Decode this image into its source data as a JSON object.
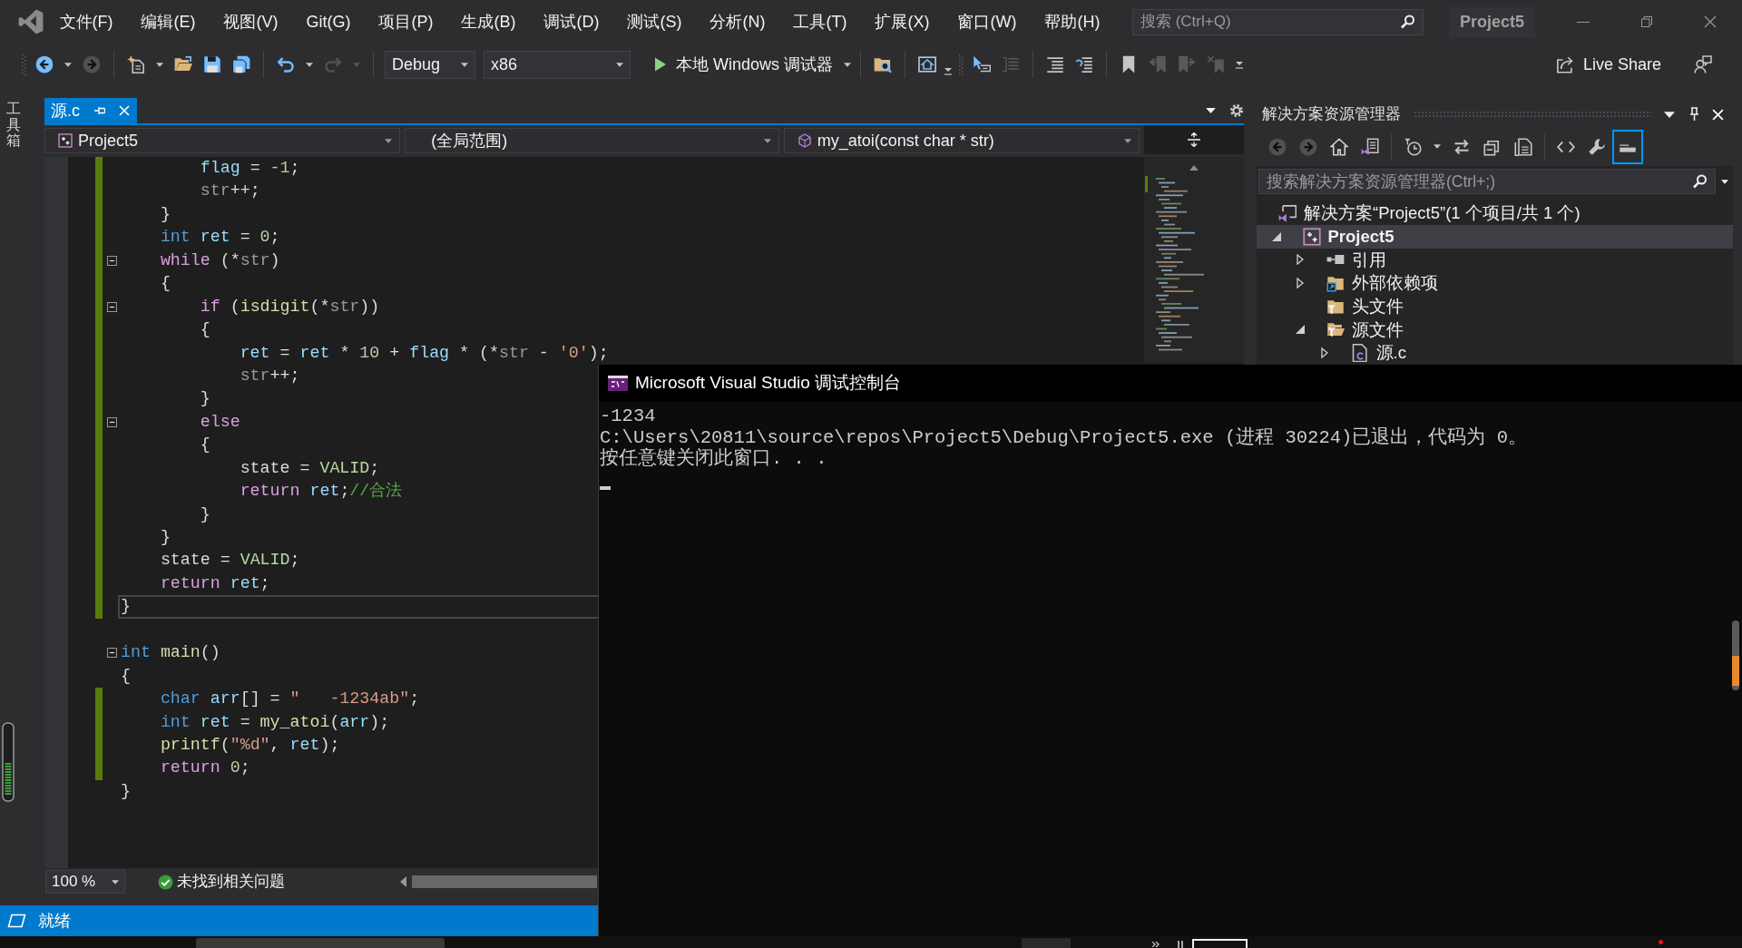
{
  "title_bar": {
    "menu": [
      "文件(F)",
      "编辑(E)",
      "视图(V)",
      "Git(G)",
      "项目(P)",
      "生成(B)",
      "调试(D)",
      "测试(S)",
      "分析(N)",
      "工具(T)",
      "扩展(X)",
      "窗口(W)",
      "帮助(H)"
    ],
    "search": {
      "placeholder": "搜索 (Ctrl+Q)"
    },
    "solution_name": "Project5"
  },
  "toolbar": {
    "buttons": [
      {
        "disabled": false
      },
      {
        "disabled": true
      },
      {
        "disabled": false
      },
      {
        "disabled": false
      },
      {
        "disabled": false
      },
      {
        "disabled": false
      },
      {
        "disabled": false
      },
      {
        "disabled": true
      },
      {
        "disabled": false
      },
      {
        "disabled": false
      },
      {
        "disabled": false
      },
      {
        "disabled": true
      },
      {
        "disabled": false
      },
      {
        "disabled": false
      },
      {
        "disabled": false
      },
      {
        "disabled": true
      },
      {
        "disabled": true
      },
      {
        "disabled": true
      }
    ],
    "configuration": "Debug",
    "platform": "x86",
    "start_target": "本地 Windows 调试器",
    "live_share": "Live Share"
  },
  "toolbox_tab": {
    "label": "工具箱"
  },
  "editor": {
    "tabs": [
      {
        "label": "源.c",
        "selected": true
      }
    ],
    "navigation": {
      "project": "Project5",
      "scope": "(全局范围)",
      "member": "my_atoi(const char * str)"
    },
    "lines": [
      {
        "tokens": [
          {
            "kind": "variable",
            "text": "        flag"
          },
          {
            "kind": "plain",
            "text": " = "
          },
          {
            "kind": "number",
            "text": "-1"
          },
          {
            "kind": "plain",
            "text": ";"
          }
        ],
        "changed": true,
        "fold_marker": false,
        "current": false
      },
      {
        "tokens": [
          {
            "kind": "parameter",
            "text": "        str"
          },
          {
            "kind": "plain",
            "text": "++;"
          }
        ],
        "changed": true,
        "fold_marker": false,
        "current": false
      },
      {
        "tokens": [
          {
            "kind": "plain",
            "text": "    }"
          }
        ],
        "changed": true,
        "fold_marker": false,
        "current": false
      },
      {
        "tokens": [
          {
            "kind": "keyword",
            "text": "    int"
          },
          {
            "kind": "variable",
            "text": " ret"
          },
          {
            "kind": "plain",
            "text": " = "
          },
          {
            "kind": "number",
            "text": "0"
          },
          {
            "kind": "plain",
            "text": ";"
          }
        ],
        "changed": true,
        "fold_marker": false,
        "current": false
      },
      {
        "tokens": [
          {
            "kind": "control",
            "text": "    while"
          },
          {
            "kind": "plain",
            "text": " (*"
          },
          {
            "kind": "parameter",
            "text": "str"
          },
          {
            "kind": "plain",
            "text": ")"
          }
        ],
        "changed": true,
        "fold_marker": true,
        "current": false
      },
      {
        "tokens": [
          {
            "kind": "plain",
            "text": "    {"
          }
        ],
        "changed": true,
        "fold_marker": false,
        "current": false
      },
      {
        "tokens": [
          {
            "kind": "control",
            "text": "        if"
          },
          {
            "kind": "plain",
            "text": " ("
          },
          {
            "kind": "function",
            "text": "isdigit"
          },
          {
            "kind": "plain",
            "text": "(*"
          },
          {
            "kind": "parameter",
            "text": "str"
          },
          {
            "kind": "plain",
            "text": "))"
          }
        ],
        "changed": true,
        "fold_marker": true,
        "current": false
      },
      {
        "tokens": [
          {
            "kind": "plain",
            "text": "        {"
          }
        ],
        "changed": true,
        "fold_marker": false,
        "current": false
      },
      {
        "tokens": [
          {
            "kind": "variable",
            "text": "            ret"
          },
          {
            "kind": "plain",
            "text": " = "
          },
          {
            "kind": "variable",
            "text": "ret"
          },
          {
            "kind": "plain",
            "text": " * "
          },
          {
            "kind": "number",
            "text": "10"
          },
          {
            "kind": "plain",
            "text": " + "
          },
          {
            "kind": "variable",
            "text": "flag"
          },
          {
            "kind": "plain",
            "text": " * (*"
          },
          {
            "kind": "parameter",
            "text": "str"
          },
          {
            "kind": "plain",
            "text": " - "
          },
          {
            "kind": "string",
            "text": "'0'"
          },
          {
            "kind": "plain",
            "text": ");"
          }
        ],
        "changed": true,
        "fold_marker": false,
        "current": false
      },
      {
        "tokens": [
          {
            "kind": "parameter",
            "text": "            str"
          },
          {
            "kind": "plain",
            "text": "++;"
          }
        ],
        "changed": true,
        "fold_marker": false,
        "current": false
      },
      {
        "tokens": [
          {
            "kind": "plain",
            "text": "        }"
          }
        ],
        "changed": true,
        "fold_marker": false,
        "current": false
      },
      {
        "tokens": [
          {
            "kind": "control",
            "text": "        else"
          }
        ],
        "changed": true,
        "fold_marker": true,
        "current": false
      },
      {
        "tokens": [
          {
            "kind": "plain",
            "text": "        {"
          }
        ],
        "changed": true,
        "fold_marker": false,
        "current": false
      },
      {
        "tokens": [
          {
            "kind": "global",
            "text": "            state"
          },
          {
            "kind": "plain",
            "text": " = "
          },
          {
            "kind": "enum",
            "text": "VALID"
          },
          {
            "kind": "plain",
            "text": ";"
          }
        ],
        "changed": true,
        "fold_marker": false,
        "current": false
      },
      {
        "tokens": [
          {
            "kind": "control",
            "text": "            return"
          },
          {
            "kind": "variable",
            "text": " ret"
          },
          {
            "kind": "plain",
            "text": ";"
          },
          {
            "kind": "comment",
            "text": "//合法"
          }
        ],
        "changed": true,
        "fold_marker": false,
        "current": false
      },
      {
        "tokens": [
          {
            "kind": "plain",
            "text": "        }"
          }
        ],
        "changed": true,
        "fold_marker": false,
        "current": false
      },
      {
        "tokens": [
          {
            "kind": "plain",
            "text": "    }"
          }
        ],
        "changed": true,
        "fold_marker": false,
        "current": false
      },
      {
        "tokens": [
          {
            "kind": "global",
            "text": "    state"
          },
          {
            "kind": "plain",
            "text": " = "
          },
          {
            "kind": "enum",
            "text": "VALID"
          },
          {
            "kind": "plain",
            "text": ";"
          }
        ],
        "changed": true,
        "fold_marker": false,
        "current": false
      },
      {
        "tokens": [
          {
            "kind": "control",
            "text": "    return"
          },
          {
            "kind": "variable",
            "text": " ret"
          },
          {
            "kind": "plain",
            "text": ";"
          }
        ],
        "changed": true,
        "fold_marker": false,
        "current": false
      },
      {
        "tokens": [
          {
            "kind": "plain",
            "text": "}"
          }
        ],
        "changed": true,
        "fold_marker": false,
        "current": true
      },
      {
        "changed": false,
        "fold_marker": false,
        "current": false
      },
      {
        "tokens": [
          {
            "kind": "keyword",
            "text": "int"
          },
          {
            "kind": "function",
            "text": " main"
          },
          {
            "kind": "plain",
            "text": "()"
          }
        ],
        "changed": false,
        "fold_marker": true,
        "current": false
      },
      {
        "tokens": [
          {
            "kind": "plain",
            "text": "{"
          }
        ],
        "changed": false,
        "fold_marker": false,
        "current": false
      },
      {
        "tokens": [
          {
            "kind": "keyword",
            "text": "    char"
          },
          {
            "kind": "variable",
            "text": " arr"
          },
          {
            "kind": "plain",
            "text": "[] = "
          },
          {
            "kind": "string",
            "text": "\"   -1234ab\""
          },
          {
            "kind": "plain",
            "text": ";"
          }
        ],
        "changed": true,
        "fold_marker": false,
        "current": false
      },
      {
        "tokens": [
          {
            "kind": "keyword",
            "text": "    int"
          },
          {
            "kind": "variable",
            "text": " ret"
          },
          {
            "kind": "plain",
            "text": " = "
          },
          {
            "kind": "function",
            "text": "my_atoi"
          },
          {
            "kind": "plain",
            "text": "("
          },
          {
            "kind": "variable",
            "text": "arr"
          },
          {
            "kind": "plain",
            "text": ");"
          }
        ],
        "changed": true,
        "fold_marker": false,
        "current": false
      },
      {
        "tokens": [
          {
            "kind": "function",
            "text": "    printf"
          },
          {
            "kind": "plain",
            "text": "("
          },
          {
            "kind": "string",
            "text": "\"%d\""
          },
          {
            "kind": "plain",
            "text": ", "
          },
          {
            "kind": "variable",
            "text": "ret"
          },
          {
            "kind": "plain",
            "text": ");"
          }
        ],
        "changed": true,
        "fold_marker": false,
        "current": false
      },
      {
        "tokens": [
          {
            "kind": "control",
            "text": "    return"
          },
          {
            "kind": "number",
            "text": " 0"
          },
          {
            "kind": "plain",
            "text": ";"
          }
        ],
        "changed": true,
        "fold_marker": false,
        "current": false
      },
      {
        "tokens": [
          {
            "kind": "plain",
            "text": "}"
          }
        ],
        "changed": false,
        "fold_marker": false,
        "current": false
      }
    ],
    "zoom": "100 %",
    "issues": "未找到相关问题"
  },
  "solution_explorer": {
    "title": "解决方案资源管理器",
    "buttons": [
      {
        "disabled": true,
        "on": false
      },
      {
        "disabled": true,
        "on": false
      },
      {
        "disabled": false,
        "on": false
      },
      {
        "disabled": false,
        "on": false
      },
      {
        "disabled": false,
        "on": false
      },
      {
        "disabled": false,
        "on": false
      },
      {
        "disabled": false,
        "on": false
      },
      {
        "disabled": false,
        "on": false
      },
      {
        "disabled": false,
        "on": false
      },
      {
        "disabled": false,
        "on": false
      },
      {
        "disabled": false,
        "on": true
      }
    ],
    "search": {
      "placeholder": "搜索解决方案资源管理器(Ctrl+;)"
    },
    "tree": [
      {
        "kind": "solution",
        "label": "解决方案“Project5”(1 个项目/共 1 个)",
        "selected": false,
        "startup": false,
        "children": [
          {
            "kind": "project",
            "label": "Project5",
            "selected": true,
            "startup": true,
            "expanded": true,
            "children": [
              {
                "kind": "references",
                "label": "引用",
                "selected": false,
                "startup": false,
                "expanded": false
              },
              {
                "kind": "external",
                "label": "外部依赖项",
                "selected": false,
                "startup": false,
                "expanded": false
              },
              {
                "kind": "filter",
                "label": "头文件",
                "selected": false,
                "startup": false
              },
              {
                "kind": "filter",
                "label": "源文件",
                "selected": false,
                "startup": false,
                "expanded": true,
                "children": [
                  {
                    "kind": "source_file",
                    "label": "源.c",
                    "selected": false,
                    "startup": false,
                    "expanded": false
                  }
                ]
              }
            ]
          }
        ]
      }
    ]
  },
  "status_bar": {
    "text": "就绪"
  },
  "console": {
    "title": "Microsoft Visual Studio 调试控制台",
    "lines": [
      "-1234",
      "C:\\Users\\20811\\source\\repos\\Project5\\Debug\\Project5.exe (进程 30224)已退出，代码为 0。",
      "按任意键关闭此窗口. . ."
    ]
  }
}
